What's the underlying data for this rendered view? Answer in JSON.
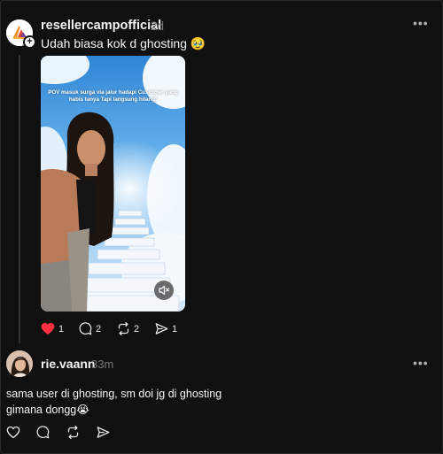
{
  "post": {
    "username": "resellercampofficial",
    "time": "2d",
    "caption": "Udah biasa kok d ghosting 🥹",
    "media": {
      "overlay_text": "POV masuk surga via jalur hadapi Customer yang habis tanya Tapi langsung hilang!",
      "mute_icon": "speaker-muted-icon"
    },
    "actions": {
      "likes": "1",
      "replies": "2",
      "reposts": "2",
      "shares": "1"
    },
    "like_color": "#ff3040"
  },
  "reply": {
    "username": "rie.vaann",
    "time": "33m",
    "text_line1": "sama user di ghosting, sm doi jg di ghosting",
    "text_line2": "gimana dongg😭"
  },
  "icons": {
    "more": "more-horizontal-icon",
    "like": "heart-icon",
    "reply": "comment-icon",
    "repost": "repost-icon",
    "share": "send-icon",
    "follow": "plus-icon"
  },
  "colors": {
    "background": "#101010",
    "muted_text": "#777777",
    "thread_line": "#333638"
  }
}
